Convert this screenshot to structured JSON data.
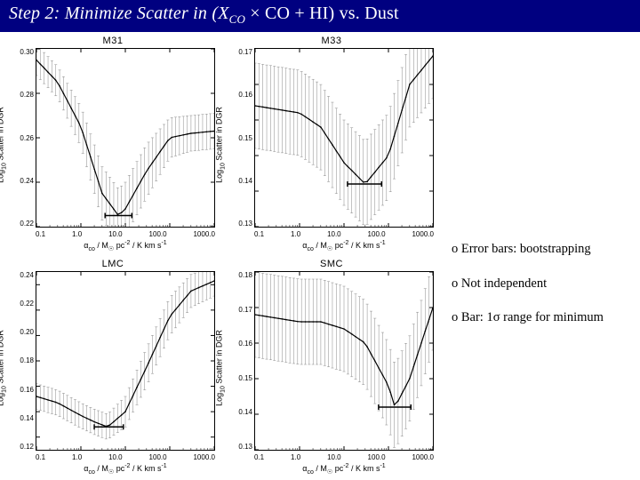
{
  "title": {
    "prefix": "Step 2: Minimize Scatter in (X",
    "subCO": "CO",
    "mid": " × CO + HI) vs. Dust"
  },
  "charts_common": {
    "xlabel_html": "α<sub>co</sub> / M<sub>☉</sub> pc<sup>-2</sup> / K km s<sup>-1</sup>",
    "ylabel_html": "Log<sub>10</sub> Scatter in DGR",
    "xmin": 0.1,
    "xmax": 1000.0,
    "xticks": [
      "0.1",
      "1.0",
      "10.0",
      "100.0",
      "1000.0"
    ]
  },
  "charts": [
    {
      "name": "M31",
      "ymin": 0.22,
      "ymax": 0.3,
      "yticks": [
        "0.30",
        "0.28",
        "0.26",
        "0.24",
        "0.22"
      ],
      "min_alpha": 7,
      "min_bar_lo": 3.5,
      "min_bar_hi": 14
    },
    {
      "name": "M33",
      "ymin": 0.13,
      "ymax": 0.18,
      "yticks": [
        "0.17",
        "0.16",
        "0.15",
        "0.14",
        "0.13"
      ],
      "min_alpha": 30,
      "min_bar_lo": 12,
      "min_bar_hi": 70
    },
    {
      "name": "LMC",
      "ymin": 0.11,
      "ymax": 0.25,
      "yticks": [
        "0.24",
        "0.22",
        "0.20",
        "0.18",
        "0.16",
        "0.14",
        "0.12"
      ],
      "min_alpha": 4,
      "min_bar_lo": 2,
      "min_bar_hi": 9
    },
    {
      "name": "SMC",
      "ymin": 0.13,
      "ymax": 0.18,
      "yticks": [
        "0.18",
        "0.17",
        "0.16",
        "0.15",
        "0.14",
        "0.13"
      ],
      "min_alpha": 140,
      "min_bar_lo": 60,
      "min_bar_hi": 320
    }
  ],
  "chart_data": [
    {
      "type": "line",
      "title": "M31",
      "xlabel": "α_co / M_sun pc^-2 / K km s^-1",
      "ylabel": "Log10 Scatter in DGR",
      "xlim": [
        0.1,
        1000
      ],
      "ylim": [
        0.22,
        0.3
      ],
      "x": [
        0.1,
        0.3,
        1,
        3,
        7,
        10,
        30,
        100,
        300,
        1000
      ],
      "y": [
        0.295,
        0.285,
        0.265,
        0.235,
        0.225,
        0.228,
        0.245,
        0.26,
        0.262,
        0.263
      ],
      "err": [
        0.007,
        0.007,
        0.009,
        0.012,
        0.012,
        0.012,
        0.012,
        0.009,
        0.008,
        0.008
      ],
      "min_range_alpha": [
        3.5,
        14
      ]
    },
    {
      "type": "line",
      "title": "M33",
      "xlabel": "α_co / M_sun pc^-2 / K km s^-1",
      "ylabel": "Log10 Scatter in DGR",
      "xlim": [
        0.1,
        1000
      ],
      "ylim": [
        0.13,
        0.18
      ],
      "x": [
        0.1,
        1,
        3,
        10,
        30,
        100,
        300,
        1000
      ],
      "y": [
        0.164,
        0.162,
        0.158,
        0.148,
        0.142,
        0.15,
        0.17,
        0.178
      ],
      "err": [
        0.012,
        0.012,
        0.012,
        0.012,
        0.012,
        0.012,
        0.012,
        0.012
      ],
      "min_range_alpha": [
        12,
        70
      ]
    },
    {
      "type": "line",
      "title": "LMC",
      "xlabel": "α_co / M_sun pc^-2 / K km s^-1",
      "ylabel": "Log10 Scatter in DGR",
      "xlim": [
        0.1,
        1000
      ],
      "ylim": [
        0.11,
        0.25
      ],
      "x": [
        0.1,
        0.3,
        1,
        2,
        4,
        10,
        30,
        100,
        300,
        1000
      ],
      "y": [
        0.152,
        0.147,
        0.137,
        0.132,
        0.128,
        0.14,
        0.175,
        0.215,
        0.235,
        0.243
      ],
      "err": [
        0.01,
        0.01,
        0.01,
        0.01,
        0.01,
        0.012,
        0.015,
        0.015,
        0.013,
        0.012
      ],
      "min_range_alpha": [
        2,
        9
      ]
    },
    {
      "type": "line",
      "title": "SMC",
      "xlabel": "α_co / M_sun pc^-2 / K km s^-1",
      "ylabel": "Log10 Scatter in DGR",
      "xlim": [
        0.1,
        1000
      ],
      "ylim": [
        0.13,
        0.18
      ],
      "x": [
        0.1,
        1,
        3,
        10,
        30,
        100,
        140,
        300,
        1000
      ],
      "y": [
        0.168,
        0.166,
        0.166,
        0.164,
        0.16,
        0.148,
        0.142,
        0.15,
        0.17
      ],
      "err": [
        0.012,
        0.012,
        0.012,
        0.012,
        0.012,
        0.012,
        0.012,
        0.012,
        0.012
      ],
      "min_range_alpha": [
        60,
        320
      ]
    }
  ],
  "notes": [
    "o Error bars: bootstrapping",
    "o Not independent",
    "o Bar: 1σ range for minimum"
  ]
}
